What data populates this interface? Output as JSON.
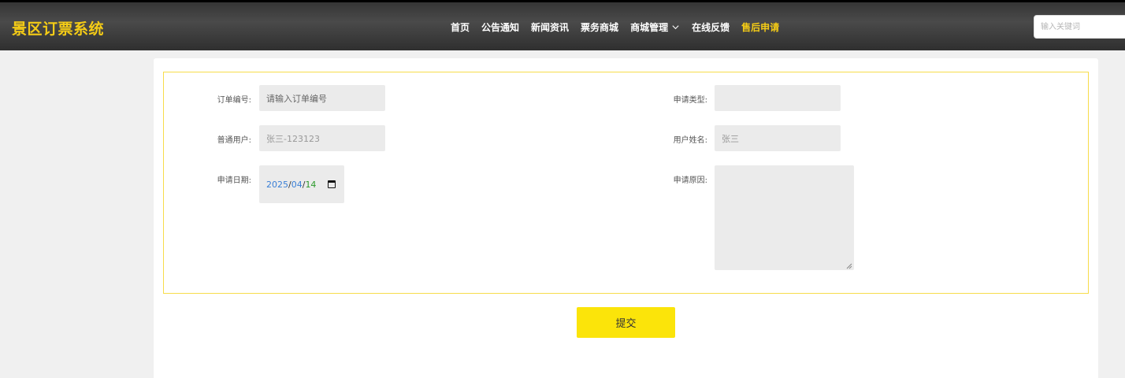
{
  "header": {
    "logo": "景区订票系统",
    "nav": [
      {
        "label": "首页"
      },
      {
        "label": "公告通知"
      },
      {
        "label": "新闻资讯"
      },
      {
        "label": "票务商城"
      },
      {
        "label": "商城管理"
      },
      {
        "label": "在线反馈"
      },
      {
        "label": "售后申请"
      }
    ],
    "search_placeholder": "输入关键词"
  },
  "form": {
    "order_no": {
      "label": "订单编号:",
      "placeholder": "请输入订单编号",
      "value": ""
    },
    "apply_type": {
      "label": "申请类型:",
      "value": ""
    },
    "user": {
      "label": "普通用户:",
      "value": "张三-123123"
    },
    "user_name": {
      "label": "用户姓名:",
      "value": "张三"
    },
    "apply_date": {
      "label": "申请日期:",
      "year": "2025",
      "month": "04",
      "day": "14",
      "sep": "/"
    },
    "reason": {
      "label": "申请原因:",
      "value": ""
    }
  },
  "submit_label": "提交",
  "colors": {
    "accent": "#f5cc16",
    "button": "#fbe40a",
    "border": "#f7dc4a"
  }
}
